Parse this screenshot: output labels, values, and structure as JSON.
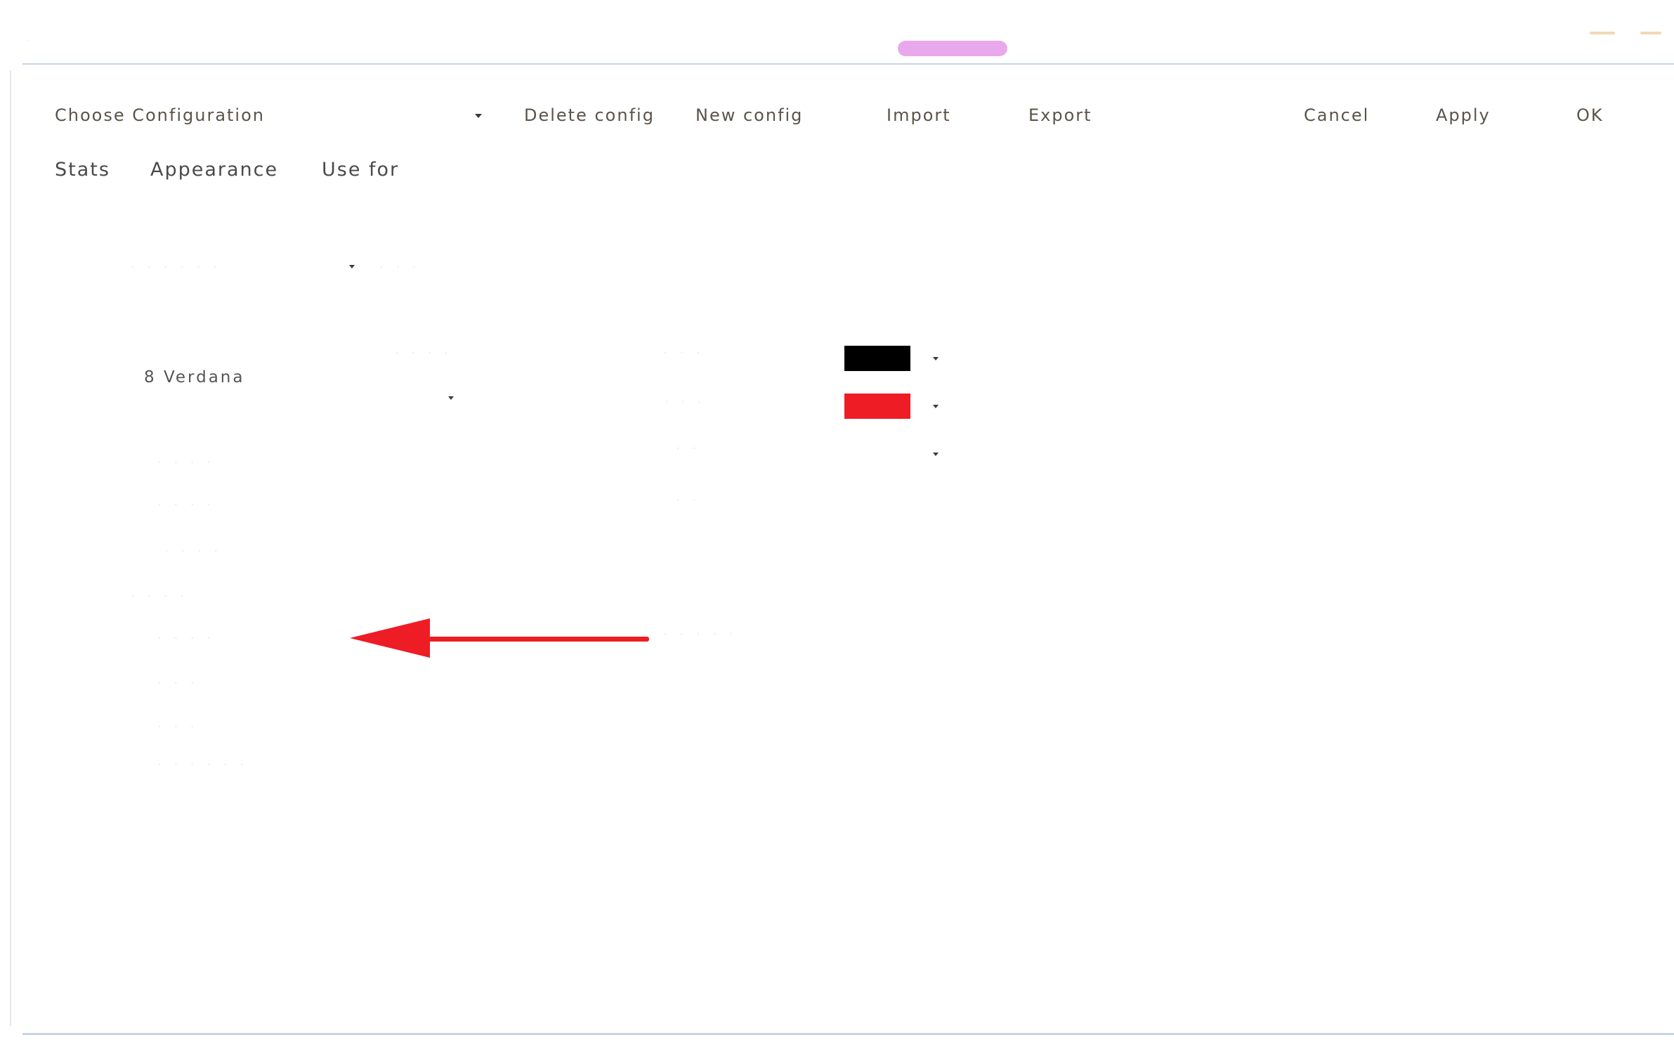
{
  "window": {
    "title": "",
    "accent_color": "#e9a8ec"
  },
  "toolbar": {
    "choose_config_label": "Choose Configuration",
    "config_select_value": "",
    "delete_label": "Delete config",
    "new_label": "New config",
    "import_label": "Import",
    "export_label": "Export",
    "cancel_label": "Cancel",
    "apply_label": "Apply",
    "ok_label": "OK"
  },
  "tabs": [
    {
      "label": "Stats"
    },
    {
      "label": "Appearance"
    },
    {
      "label": "Use for"
    }
  ],
  "appearance": {
    "font_value": "8 Verdana",
    "colors": {
      "swatch_1": "#000000",
      "swatch_2": "#ee1c24"
    }
  },
  "annotation": {
    "arrow_color": "#ee1c24",
    "direction": "left"
  },
  "icons": {
    "dropdown": "chevron-down-icon",
    "arrow": "arrow-left-icon"
  }
}
